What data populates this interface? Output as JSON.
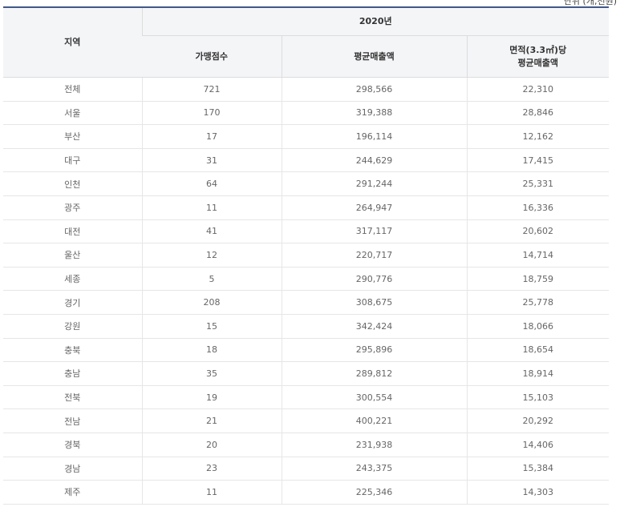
{
  "unit_note": "단위 (개,천원)",
  "table": {
    "headers": {
      "region": "지역",
      "year": "2020년",
      "stores": "가맹점수",
      "avg_sales": "평균매출액",
      "area_sales_line1": "면적(3.3㎡)당",
      "area_sales_line2": "평균매출액"
    },
    "rows": [
      {
        "region": "전체",
        "stores": "721",
        "avg_sales": "298,566",
        "area_sales": "22,310"
      },
      {
        "region": "서울",
        "stores": "170",
        "avg_sales": "319,388",
        "area_sales": "28,846"
      },
      {
        "region": "부산",
        "stores": "17",
        "avg_sales": "196,114",
        "area_sales": "12,162"
      },
      {
        "region": "대구",
        "stores": "31",
        "avg_sales": "244,629",
        "area_sales": "17,415"
      },
      {
        "region": "인천",
        "stores": "64",
        "avg_sales": "291,244",
        "area_sales": "25,331"
      },
      {
        "region": "광주",
        "stores": "11",
        "avg_sales": "264,947",
        "area_sales": "16,336"
      },
      {
        "region": "대전",
        "stores": "41",
        "avg_sales": "317,117",
        "area_sales": "20,602"
      },
      {
        "region": "울산",
        "stores": "12",
        "avg_sales": "220,717",
        "area_sales": "14,714"
      },
      {
        "region": "세종",
        "stores": "5",
        "avg_sales": "290,776",
        "area_sales": "18,759"
      },
      {
        "region": "경기",
        "stores": "208",
        "avg_sales": "308,675",
        "area_sales": "25,778"
      },
      {
        "region": "강원",
        "stores": "15",
        "avg_sales": "342,424",
        "area_sales": "18,066"
      },
      {
        "region": "충북",
        "stores": "18",
        "avg_sales": "295,896",
        "area_sales": "18,654"
      },
      {
        "region": "충남",
        "stores": "35",
        "avg_sales": "289,812",
        "area_sales": "18,914"
      },
      {
        "region": "전북",
        "stores": "19",
        "avg_sales": "300,554",
        "area_sales": "15,103"
      },
      {
        "region": "전남",
        "stores": "21",
        "avg_sales": "400,221",
        "area_sales": "20,292"
      },
      {
        "region": "경북",
        "stores": "20",
        "avg_sales": "231,938",
        "area_sales": "14,406"
      },
      {
        "region": "경남",
        "stores": "23",
        "avg_sales": "243,375",
        "area_sales": "15,384"
      },
      {
        "region": "제주",
        "stores": "11",
        "avg_sales": "225,346",
        "area_sales": "14,303"
      }
    ]
  }
}
